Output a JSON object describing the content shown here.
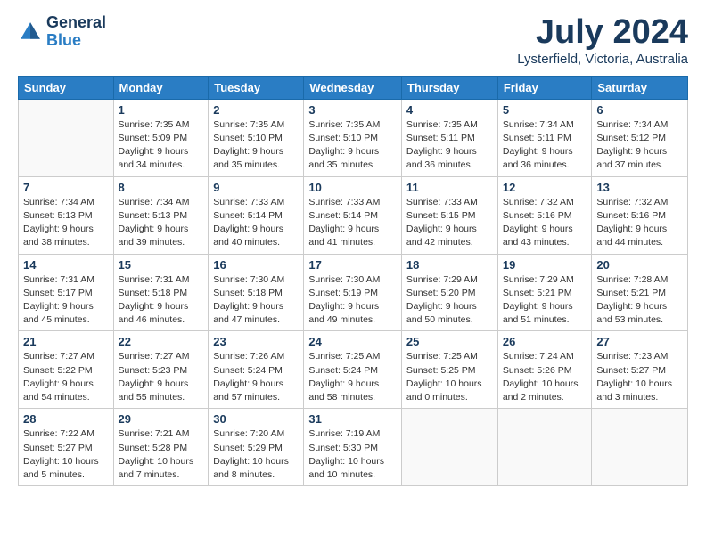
{
  "header": {
    "logo_line1": "General",
    "logo_line2": "Blue",
    "month": "July 2024",
    "location": "Lysterfield, Victoria, Australia"
  },
  "weekdays": [
    "Sunday",
    "Monday",
    "Tuesday",
    "Wednesday",
    "Thursday",
    "Friday",
    "Saturday"
  ],
  "weeks": [
    [
      {
        "day": "",
        "info": ""
      },
      {
        "day": "1",
        "info": "Sunrise: 7:35 AM\nSunset: 5:09 PM\nDaylight: 9 hours\nand 34 minutes."
      },
      {
        "day": "2",
        "info": "Sunrise: 7:35 AM\nSunset: 5:10 PM\nDaylight: 9 hours\nand 35 minutes."
      },
      {
        "day": "3",
        "info": "Sunrise: 7:35 AM\nSunset: 5:10 PM\nDaylight: 9 hours\nand 35 minutes."
      },
      {
        "day": "4",
        "info": "Sunrise: 7:35 AM\nSunset: 5:11 PM\nDaylight: 9 hours\nand 36 minutes."
      },
      {
        "day": "5",
        "info": "Sunrise: 7:34 AM\nSunset: 5:11 PM\nDaylight: 9 hours\nand 36 minutes."
      },
      {
        "day": "6",
        "info": "Sunrise: 7:34 AM\nSunset: 5:12 PM\nDaylight: 9 hours\nand 37 minutes."
      }
    ],
    [
      {
        "day": "7",
        "info": "Sunrise: 7:34 AM\nSunset: 5:13 PM\nDaylight: 9 hours\nand 38 minutes."
      },
      {
        "day": "8",
        "info": "Sunrise: 7:34 AM\nSunset: 5:13 PM\nDaylight: 9 hours\nand 39 minutes."
      },
      {
        "day": "9",
        "info": "Sunrise: 7:33 AM\nSunset: 5:14 PM\nDaylight: 9 hours\nand 40 minutes."
      },
      {
        "day": "10",
        "info": "Sunrise: 7:33 AM\nSunset: 5:14 PM\nDaylight: 9 hours\nand 41 minutes."
      },
      {
        "day": "11",
        "info": "Sunrise: 7:33 AM\nSunset: 5:15 PM\nDaylight: 9 hours\nand 42 minutes."
      },
      {
        "day": "12",
        "info": "Sunrise: 7:32 AM\nSunset: 5:16 PM\nDaylight: 9 hours\nand 43 minutes."
      },
      {
        "day": "13",
        "info": "Sunrise: 7:32 AM\nSunset: 5:16 PM\nDaylight: 9 hours\nand 44 minutes."
      }
    ],
    [
      {
        "day": "14",
        "info": "Sunrise: 7:31 AM\nSunset: 5:17 PM\nDaylight: 9 hours\nand 45 minutes."
      },
      {
        "day": "15",
        "info": "Sunrise: 7:31 AM\nSunset: 5:18 PM\nDaylight: 9 hours\nand 46 minutes."
      },
      {
        "day": "16",
        "info": "Sunrise: 7:30 AM\nSunset: 5:18 PM\nDaylight: 9 hours\nand 47 minutes."
      },
      {
        "day": "17",
        "info": "Sunrise: 7:30 AM\nSunset: 5:19 PM\nDaylight: 9 hours\nand 49 minutes."
      },
      {
        "day": "18",
        "info": "Sunrise: 7:29 AM\nSunset: 5:20 PM\nDaylight: 9 hours\nand 50 minutes."
      },
      {
        "day": "19",
        "info": "Sunrise: 7:29 AM\nSunset: 5:21 PM\nDaylight: 9 hours\nand 51 minutes."
      },
      {
        "day": "20",
        "info": "Sunrise: 7:28 AM\nSunset: 5:21 PM\nDaylight: 9 hours\nand 53 minutes."
      }
    ],
    [
      {
        "day": "21",
        "info": "Sunrise: 7:27 AM\nSunset: 5:22 PM\nDaylight: 9 hours\nand 54 minutes."
      },
      {
        "day": "22",
        "info": "Sunrise: 7:27 AM\nSunset: 5:23 PM\nDaylight: 9 hours\nand 55 minutes."
      },
      {
        "day": "23",
        "info": "Sunrise: 7:26 AM\nSunset: 5:24 PM\nDaylight: 9 hours\nand 57 minutes."
      },
      {
        "day": "24",
        "info": "Sunrise: 7:25 AM\nSunset: 5:24 PM\nDaylight: 9 hours\nand 58 minutes."
      },
      {
        "day": "25",
        "info": "Sunrise: 7:25 AM\nSunset: 5:25 PM\nDaylight: 10 hours\nand 0 minutes."
      },
      {
        "day": "26",
        "info": "Sunrise: 7:24 AM\nSunset: 5:26 PM\nDaylight: 10 hours\nand 2 minutes."
      },
      {
        "day": "27",
        "info": "Sunrise: 7:23 AM\nSunset: 5:27 PM\nDaylight: 10 hours\nand 3 minutes."
      }
    ],
    [
      {
        "day": "28",
        "info": "Sunrise: 7:22 AM\nSunset: 5:27 PM\nDaylight: 10 hours\nand 5 minutes."
      },
      {
        "day": "29",
        "info": "Sunrise: 7:21 AM\nSunset: 5:28 PM\nDaylight: 10 hours\nand 7 minutes."
      },
      {
        "day": "30",
        "info": "Sunrise: 7:20 AM\nSunset: 5:29 PM\nDaylight: 10 hours\nand 8 minutes."
      },
      {
        "day": "31",
        "info": "Sunrise: 7:19 AM\nSunset: 5:30 PM\nDaylight: 10 hours\nand 10 minutes."
      },
      {
        "day": "",
        "info": ""
      },
      {
        "day": "",
        "info": ""
      },
      {
        "day": "",
        "info": ""
      }
    ]
  ]
}
